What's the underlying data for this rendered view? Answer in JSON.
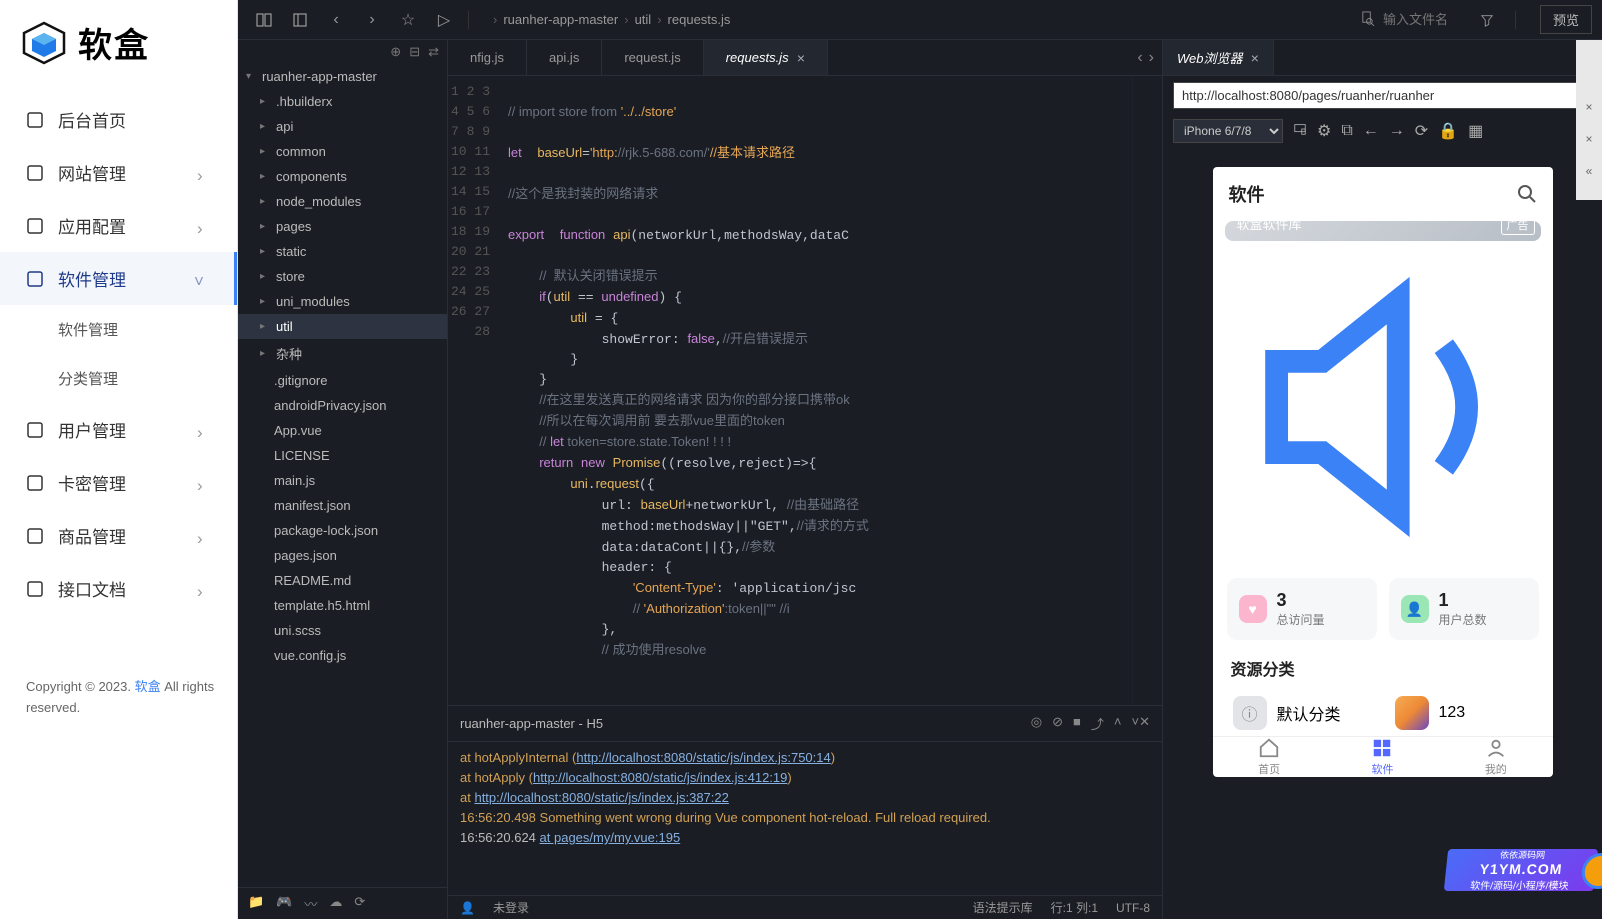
{
  "logo": {
    "text": "软盒"
  },
  "admin_menu": [
    {
      "icon": "home",
      "label": "后台首页",
      "expandable": false
    },
    {
      "icon": "globe",
      "label": "网站管理",
      "expandable": true
    },
    {
      "icon": "grid",
      "label": "应用配置",
      "expandable": true
    },
    {
      "icon": "download",
      "label": "软件管理",
      "expandable": true,
      "expanded": true,
      "children": [
        "软件管理",
        "分类管理"
      ]
    },
    {
      "icon": "user",
      "label": "用户管理",
      "expandable": true
    },
    {
      "icon": "card",
      "label": "卡密管理",
      "expandable": true
    },
    {
      "icon": "bag",
      "label": "商品管理",
      "expandable": true
    },
    {
      "icon": "doc",
      "label": "接口文档",
      "expandable": true
    }
  ],
  "footer": {
    "prefix": "Copyright © 2023. ",
    "link": "软盒",
    "suffix": " All rights reserved."
  },
  "breadcrumb": [
    "ruanher-app-master",
    "util",
    "requests.js"
  ],
  "search_placeholder": "输入文件名",
  "preview_button": "预览",
  "file_tree": {
    "root": "ruanher-app-master",
    "folders": [
      ".hbuilderx",
      "api",
      "common",
      "components",
      "node_modules",
      "pages",
      "static",
      "store",
      "uni_modules",
      "util",
      "杂种"
    ],
    "selected": "util",
    "files": [
      ".gitignore",
      "androidPrivacy.json",
      "App.vue",
      "LICENSE",
      "main.js",
      "manifest.json",
      "package-lock.json",
      "pages.json",
      "README.md",
      "template.h5.html",
      "uni.scss",
      "vue.config.js"
    ]
  },
  "tabs": [
    "nfig.js",
    "api.js",
    "request.js",
    "requests.js"
  ],
  "active_tab": "requests.js",
  "preview_tab": "Web浏览器",
  "address_bar": "http://localhost:8080/pages/ruanher/ruanher",
  "device": "iPhone 6/7/8",
  "code_lines": [
    "",
    "// import store from '../../store'",
    "",
    "let  baseUrl='http://rjk.5-688.com/'//基本请求路径",
    "",
    "//这个是我封装的网络请求",
    "",
    "export  function api(networkUrl,methodsWay,dataC",
    "",
    "    //  默认关闭错误提示",
    "    if(util == undefined) {",
    "        util = {",
    "            showError: false,//开启错误提示",
    "        }",
    "    }",
    "    //在这里发送真正的网络请求 因为你的部分接口携带ok",
    "    //所以在每次调用前 要去那vue里面的token",
    "    // let token=store.state.Token! ! ! !",
    "    return new Promise((resolve,reject)=>{",
    "        uni.request({",
    "            url: baseUrl+networkUrl, //由基础路径",
    "            method:methodsWay||\"GET\",//请求的方式",
    "            data:dataCont||{},//参数",
    "            header: {",
    "                'Content-Type': 'application/jsc",
    "                // 'Authorization':token||\"\" //i",
    "            },",
    "            // 成功使用resolve"
  ],
  "console": {
    "title": "ruanher-app-master - H5",
    "lines": [
      {
        "pre": "    at hotApplyInternal (",
        "link": "http://localhost:8080/static/js/index.js:750:14",
        "post": ")",
        "warn": true
      },
      {
        "pre": "    at hotApply (",
        "link": "http://localhost:8080/static/js/index.js:412:19",
        "post": ")",
        "warn": true
      },
      {
        "pre": "    at ",
        "link": "http://localhost:8080/static/js/index.js:387:22",
        "post": "",
        "warn": true
      },
      {
        "text": "16:56:20.498 Something went wrong during Vue component hot-reload. Full reload required.",
        "warn": true
      },
      {
        "pre": "16:56:20.624   ",
        "link": "at pages/my/my.vue:195",
        "post": ""
      }
    ]
  },
  "status_bar": {
    "login": "未登录",
    "syntax": "语法提示库",
    "line_col": "行:1  列:1",
    "encoding": "UTF-8"
  },
  "phone": {
    "title": "软件",
    "banner_label": "软盒软件库",
    "banner_ad": "广告",
    "stat1_num": "3",
    "stat1_label": "总访问量",
    "stat2_num": "1",
    "stat2_label": "用户总数",
    "section": "资源分类",
    "cat1": "默认分类",
    "cat2": "123",
    "tabbar": [
      "首页",
      "软件",
      "我的"
    ]
  },
  "watermark": {
    "big": "Y1YM.COM",
    "sub": "软件/源码/小程序/模块",
    "brand": "依依源码网"
  }
}
